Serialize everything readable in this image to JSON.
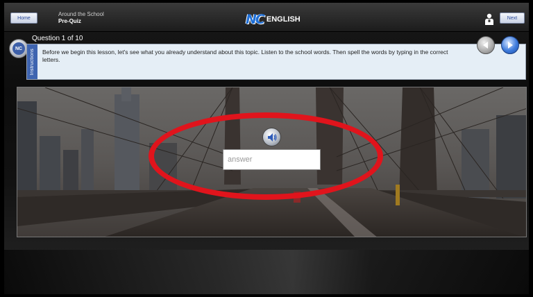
{
  "header": {
    "home_label": "Home",
    "next_label": "Next",
    "course_title": "Around the School",
    "course_subtitle": "Pre-Quiz",
    "logo_mark": "NC",
    "logo_text": "ENGLISH"
  },
  "question": {
    "counter": "Question 1 of 10",
    "badge": "NC",
    "instructions_tab": "Instructions",
    "instructions_text": "Before we begin this lesson, let's see what you already understand about this topic. Listen to the school words. Then spell the words by typing in the correct letters."
  },
  "answer": {
    "placeholder": "answer",
    "value": ""
  },
  "colors": {
    "accent_blue": "#3e64b0",
    "highlight_red": "#e0141c",
    "instruction_bg": "#e5eef6"
  },
  "icons": {
    "user": "user-icon",
    "prev": "arrow-left-icon",
    "next": "arrow-right-icon",
    "audio": "speaker-icon"
  }
}
